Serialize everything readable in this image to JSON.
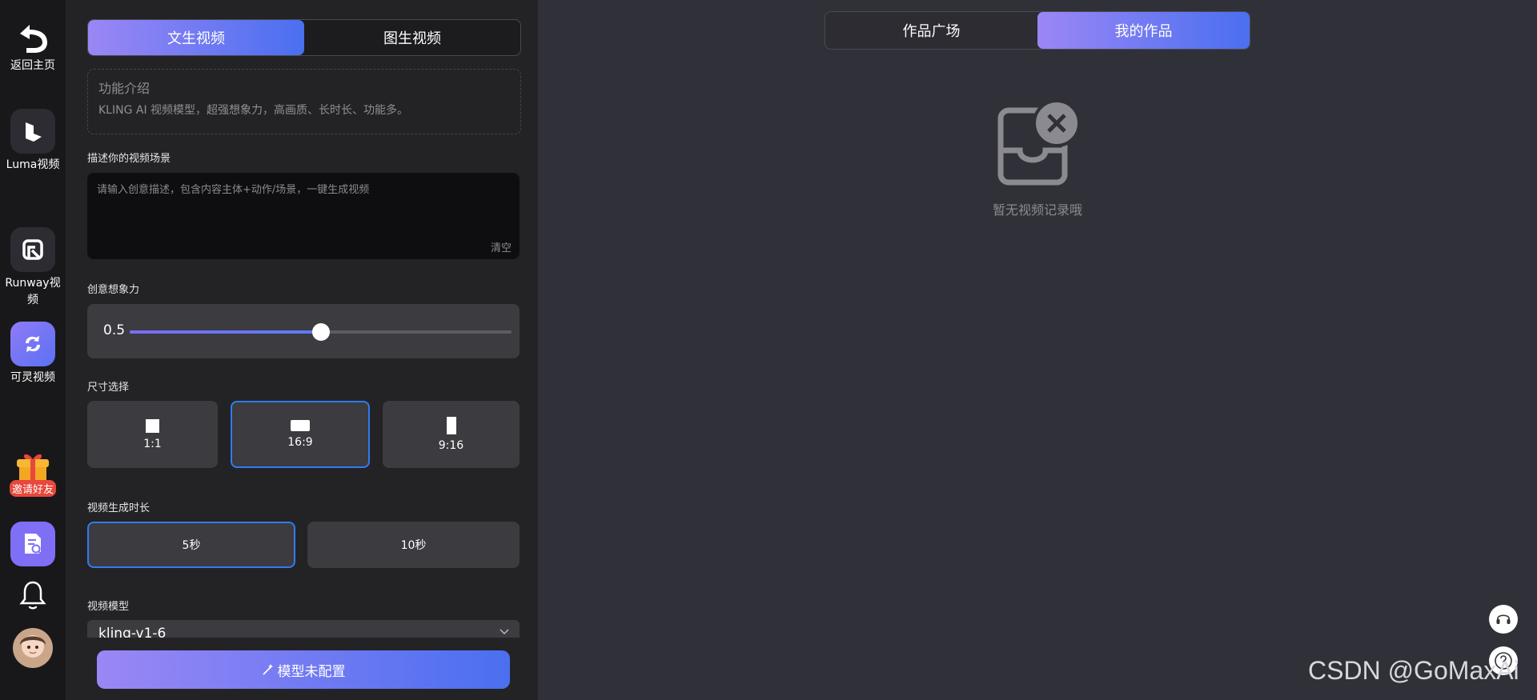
{
  "rail": {
    "back_label": "返回主页",
    "items": [
      {
        "label": "Luma视频",
        "icon": "luma-icon"
      },
      {
        "label": "Runway视频",
        "icon": "runway-icon"
      },
      {
        "label": "可灵视频",
        "icon": "kling-icon"
      }
    ],
    "invite_label": "邀请好友"
  },
  "panel": {
    "tabs": [
      "文生视频",
      "图生视频"
    ],
    "active_tab": 0,
    "intro_title": "功能介绍",
    "intro_desc": "KLING AI 视频模型，超强想象力，高画质、长时长、功能多。",
    "prompt_label": "描述你的视频场景",
    "prompt_placeholder": "请输入创意描述，包含内容主体+动作/场景，一键生成视频",
    "clear_label": "清空",
    "creativity_label": "创意想象力",
    "creativity_value": "0.5",
    "creativity_fraction": 0.5,
    "size_label": "尺寸选择",
    "sizes": [
      "1:1",
      "16:9",
      "9:16"
    ],
    "selected_size": "16:9",
    "duration_label": "视频生成时长",
    "durations": [
      "5秒",
      "10秒"
    ],
    "selected_duration": "5秒",
    "model_label": "视频模型",
    "model_value": "kling-v1-6",
    "generate_label": "模型未配置"
  },
  "main": {
    "tabs": [
      "作品广场",
      "我的作品"
    ],
    "active_tab": 1,
    "empty_text": "暂无视频记录哦"
  },
  "watermark": "CSDN @GoMaxAi",
  "colors": {
    "accent_gradient_start": "#9b87f5",
    "accent_gradient_end": "#4a6ff0",
    "selected_border": "#2f7cf0",
    "panel_bg": "#232326",
    "main_bg": "#303038"
  }
}
